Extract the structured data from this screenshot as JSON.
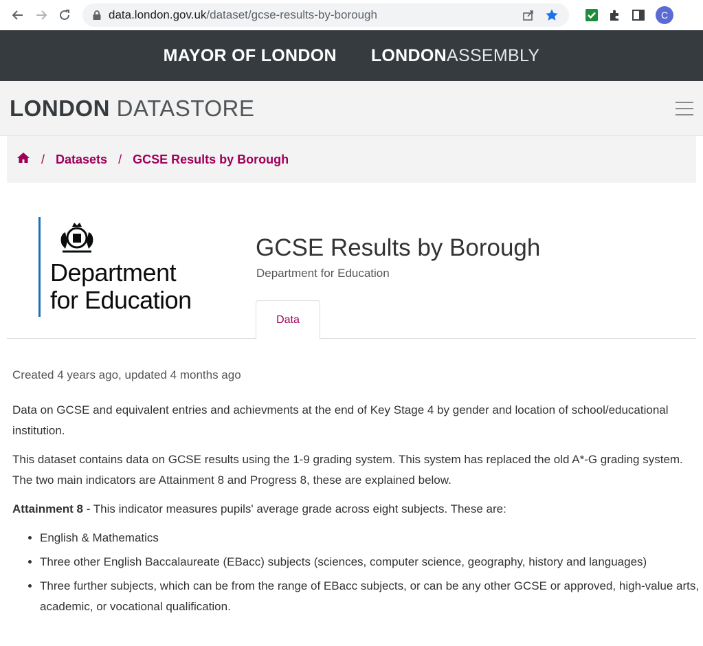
{
  "browser": {
    "url_host": "data.london.gov.uk",
    "url_path": "/dataset/gcse-results-by-borough",
    "profile_initial": "C"
  },
  "site_nav": {
    "mayor": "MAYOR OF LONDON",
    "assembly_bold": "LONDON",
    "assembly_light": "ASSEMBLY"
  },
  "datastore": {
    "logo_bold": "LONDON",
    "logo_light": "DATASTORE"
  },
  "breadcrumb": {
    "home_icon": "home-icon",
    "separator": "/",
    "items": [
      "Datasets",
      "GCSE Results by Borough"
    ]
  },
  "publisher_logo": {
    "line1": "Department",
    "line2": "for Education"
  },
  "dataset": {
    "title": "GCSE Results by Borough",
    "organization": "Department for Education",
    "tabs": [
      {
        "label": "Data"
      }
    ]
  },
  "content": {
    "meta": "Created 4 years ago, updated 4 months ago",
    "para1": "Data on GCSE and equivalent entries and achievments at the end of Key Stage 4 by gender and location of school/educational institution.",
    "para2": "This dataset contains data on GCSE results using the 1-9 grading system. This system has replaced the old A*-G grading system. The two main indicators are Attainment 8 and Progress 8, these are explained below.",
    "para3_bold": "Attainment 8",
    "para3_rest": " - This indicator measures pupils' average grade across eight subjects. These are:",
    "bullets": [
      "English & Mathematics",
      "Three other English Baccalaureate (EBacc) subjects (sciences, computer science, geography, history and languages)",
      "Three further subjects, which can be from the range of EBacc subjects, or can be any other GCSE or approved, high-value arts, academic, or vocational qualification."
    ]
  },
  "colors": {
    "accent": "#9e0059",
    "dark_bar": "#353b3f",
    "dfe_blue": "#1d70b8"
  }
}
